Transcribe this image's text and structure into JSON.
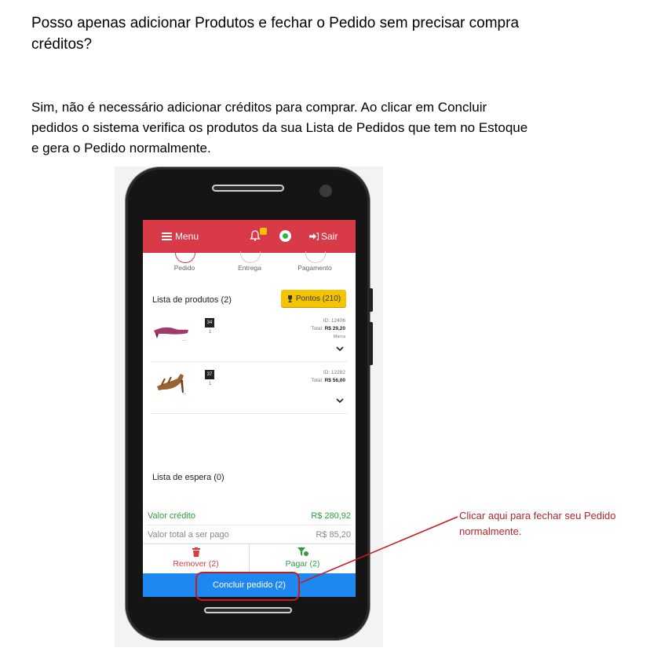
{
  "question": "Posso apenas adicionar Produtos e fechar o Pedido sem precisar compra créditos?",
  "answer": "Sim, não é necessário adicionar créditos para comprar. Ao clicar em Concluir pedidos o sistema verifica os produtos da sua Lista de Pedidos que tem no Estoque e gera o Pedido normalmente.",
  "app": {
    "topbar": {
      "menu_label": "Menu",
      "sair_label": "Sair",
      "color": "#d93a48",
      "icons": [
        "menu-icon",
        "bell-icon",
        "whatsapp-icon",
        "logout-icon"
      ]
    },
    "steps": [
      "Pedido",
      "Entrega",
      "Pagamento"
    ],
    "product_list": {
      "title": "Lista de produtos (2)",
      "pontos_label": "Pontos (210)",
      "items": [
        {
          "size": "34",
          "qty": "1",
          "dots": "...",
          "id": "ID: 12406",
          "total_label": "Total:",
          "total": "R$ 29,20",
          "extra": "Marca"
        },
        {
          "size": "37",
          "qty": "1",
          "dots": "...",
          "id": "ID: 12282",
          "total_label": "Total:",
          "total": "R$ 56,00",
          "extra": ""
        }
      ]
    },
    "waiting_list": {
      "title": "Lista de espera (0)"
    },
    "valor_credito": {
      "label": "Valor crédito",
      "value": "R$ 280,92",
      "color": "#2e9e3e"
    },
    "valor_total": {
      "label": "Valor total a ser pago",
      "value": "R$ 85,20"
    },
    "remover_label": "Remover (2)",
    "pagar_label": "Pagar (2)",
    "concluir_label": "Concluir pedido (2)"
  },
  "annotation": {
    "text": "Clicar aqui para fechar seu Pedido normalmente.",
    "color": "#b3262a"
  }
}
